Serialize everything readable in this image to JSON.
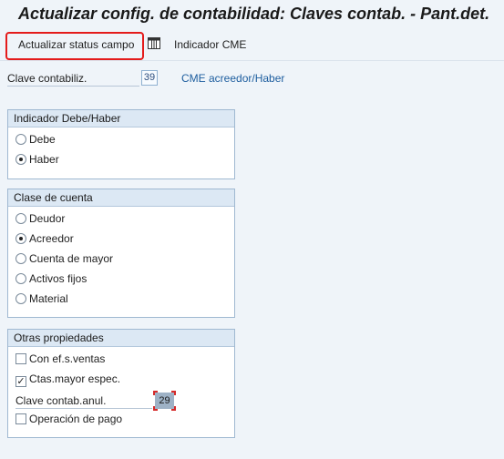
{
  "header": {
    "title": "Actualizar config. de contabilidad: Claves contab. - Pant.det."
  },
  "toolbar": {
    "update_status_label": "Actualizar status campo",
    "cme_indicator_label": "Indicador CME",
    "grid_icon": "table-grid-icon",
    "highlight_color": "#e41b1b"
  },
  "posting_key": {
    "label": "Clave contabiliz.",
    "value": "39",
    "description": "CME acreedor/Haber"
  },
  "debit_credit": {
    "title": "Indicador Debe/Haber",
    "options": [
      {
        "label": "Debe",
        "selected": false
      },
      {
        "label": "Haber",
        "selected": true
      }
    ]
  },
  "account_type": {
    "title": "Clase de cuenta",
    "options": [
      {
        "label": "Deudor",
        "selected": false
      },
      {
        "label": "Acreedor",
        "selected": true
      },
      {
        "label": "Cuenta de mayor",
        "selected": false
      },
      {
        "label": "Activos fijos",
        "selected": false
      },
      {
        "label": "Material",
        "selected": false
      }
    ]
  },
  "other_props": {
    "title": "Otras propiedades",
    "sales_tax": {
      "label": "Con ef.s.ventas",
      "checked": false
    },
    "special_gl": {
      "label": "Ctas.mayor espec.",
      "checked": true
    },
    "reversal_key": {
      "label": "Clave contab.anul.",
      "value": "29"
    },
    "payment": {
      "label": "Operación de pago",
      "checked": false
    }
  }
}
